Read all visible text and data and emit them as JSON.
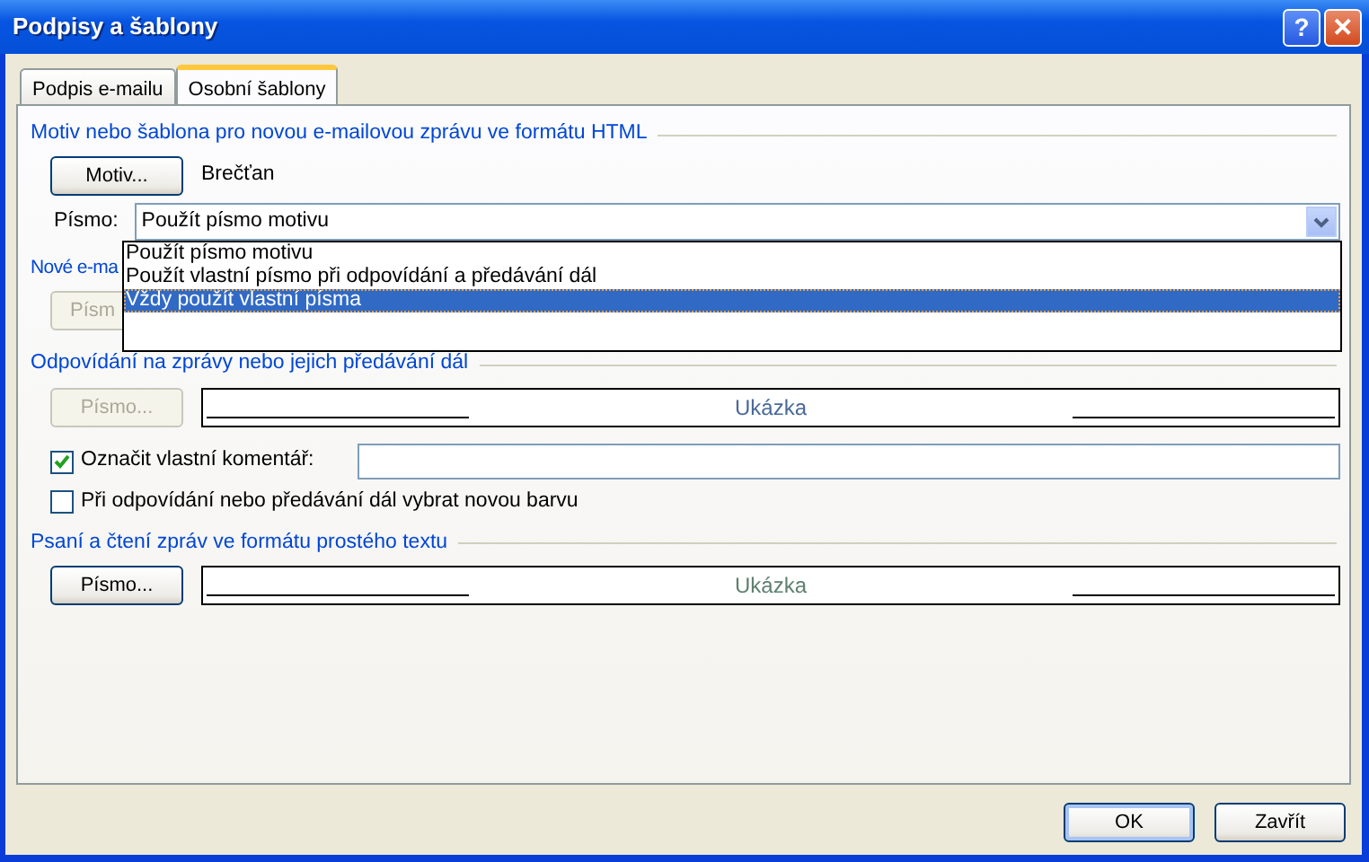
{
  "window": {
    "title": "Podpisy a šablony",
    "help_button": "?",
    "close_button": "✕"
  },
  "tabs": [
    {
      "label": "Podpis e-mailu",
      "selected": false
    },
    {
      "label": "Osobní šablony",
      "selected": true
    }
  ],
  "html_theme": {
    "heading": "Motiv nebo šablona pro novou e-mailovou zprávu ve formátu HTML",
    "theme_button": {
      "label": "Motiv...",
      "disabled": false
    },
    "theme_name": "Brečťan",
    "font_label": "Písmo:",
    "font_select": {
      "value": "Použít písmo motivu",
      "expanded": true,
      "options": [
        {
          "label": "Použít písmo motivu",
          "highlighted": false
        },
        {
          "label": "Použít vlastní písmo při odpovídání a předávání dál",
          "highlighted": false
        },
        {
          "label": "Vždy použít vlastní písma",
          "highlighted": true
        }
      ]
    }
  },
  "new_mail": {
    "heading": "Nové e-ma",
    "font_button": {
      "label": "Písm",
      "disabled": true
    }
  },
  "reply": {
    "heading": "Odpovídání na zprávy nebo jejich předávání dál",
    "font_button": {
      "label": "Písmo...",
      "disabled": true
    },
    "preview": "Ukázka",
    "mark_comments": {
      "label": "Označit vlastní komentář:",
      "checked": true
    },
    "new_color": {
      "label": "Při odpovídání nebo předávání dál vybrat novou barvu",
      "checked": false
    }
  },
  "plain_text": {
    "heading": "Psaní a čtení zpráv ve formátu prostého textu",
    "font_button": {
      "label": "Písmo...",
      "disabled": false
    },
    "preview": "Ukázka"
  },
  "buttons": [
    {
      "label": "OK",
      "default": true
    },
    {
      "label": "Zavřít",
      "default": false
    }
  ]
}
